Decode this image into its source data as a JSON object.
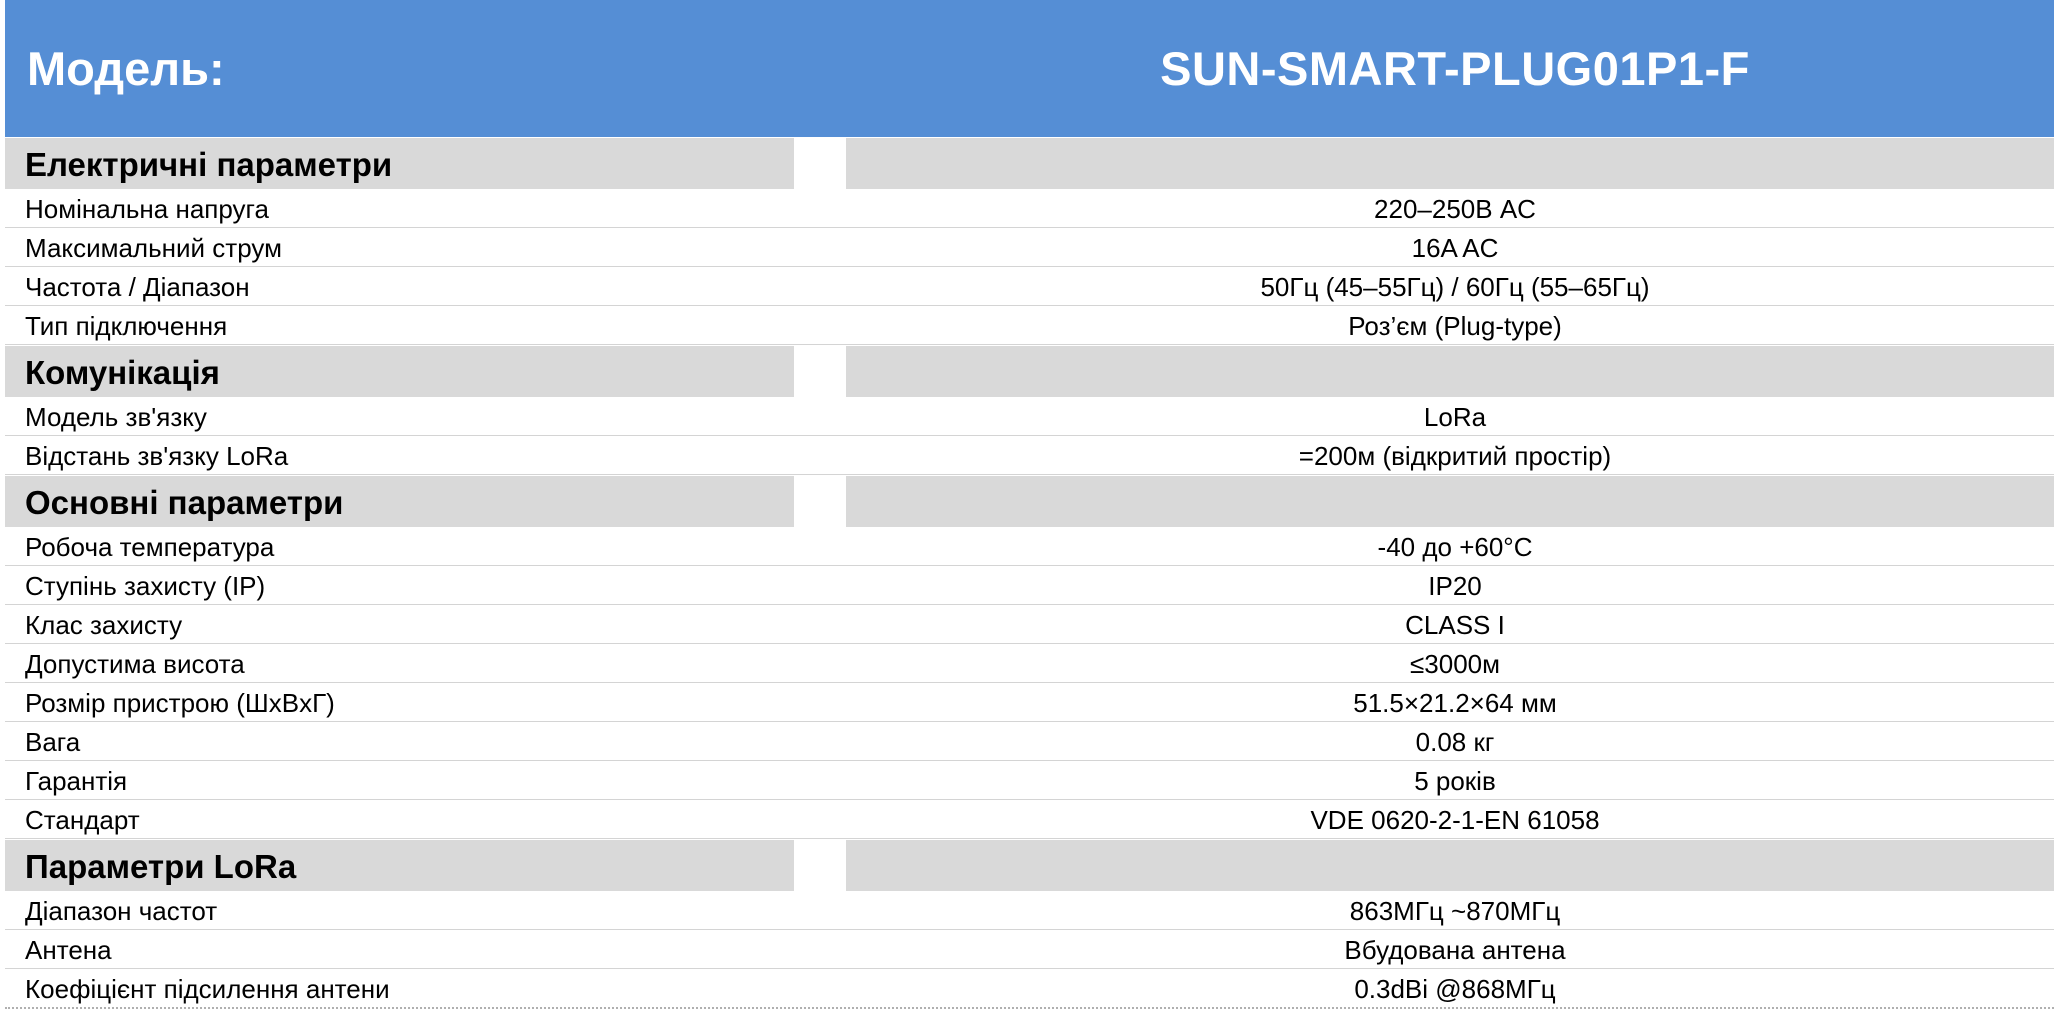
{
  "header": {
    "label": "Модель:",
    "value": "SUN-SMART-PLUG01P1-F",
    "color": "#558ed5"
  },
  "sections": [
    {
      "title": "Електричні параметри",
      "rows": [
        {
          "label": "Номінальна напруга",
          "value": "220–250В AC"
        },
        {
          "label": "Максимальний струм",
          "value": "16A AC"
        },
        {
          "label": "Частота / Діапазон",
          "value": "50Гц (45–55Гц) / 60Гц (55–65Гц)"
        },
        {
          "label": "Тип підключення",
          "value": "Роз’єм (Plug-type)"
        }
      ]
    },
    {
      "title": "Комунікація",
      "rows": [
        {
          "label": "Модель зв'язку",
          "value": "LoRa"
        },
        {
          "label": "Відстань зв'язку LoRa",
          "value": "=200м (відкритий простір)"
        }
      ]
    },
    {
      "title": "Основні параметри",
      "rows": [
        {
          "label": "Робоча температура",
          "value": "-40 до +60°C"
        },
        {
          "label": "Ступінь захисту (IP)",
          "value": "IP20"
        },
        {
          "label": "Клас захисту",
          "value": "CLASS I"
        },
        {
          "label": "Допустима висота",
          "value": "≤3000м"
        },
        {
          "label": "Розмір пристрою (ШxВxГ)",
          "value": "51.5×21.2×64 мм"
        },
        {
          "label": "Вага",
          "value": "0.08 кг"
        },
        {
          "label": "Гарантія",
          "value": "5 років"
        },
        {
          "label": "Стандарт",
          "value": "VDE 0620-2-1-EN 61058"
        }
      ]
    },
    {
      "title": "Параметри LoRa",
      "rows": [
        {
          "label": "Діапазон частот",
          "value": "863МГц ~870МГц"
        },
        {
          "label": "Антена",
          "value": "Вбудована антена"
        },
        {
          "label": "Коефіцієнт підсилення антени",
          "value": "0.3dBi @868МГц"
        }
      ]
    }
  ]
}
